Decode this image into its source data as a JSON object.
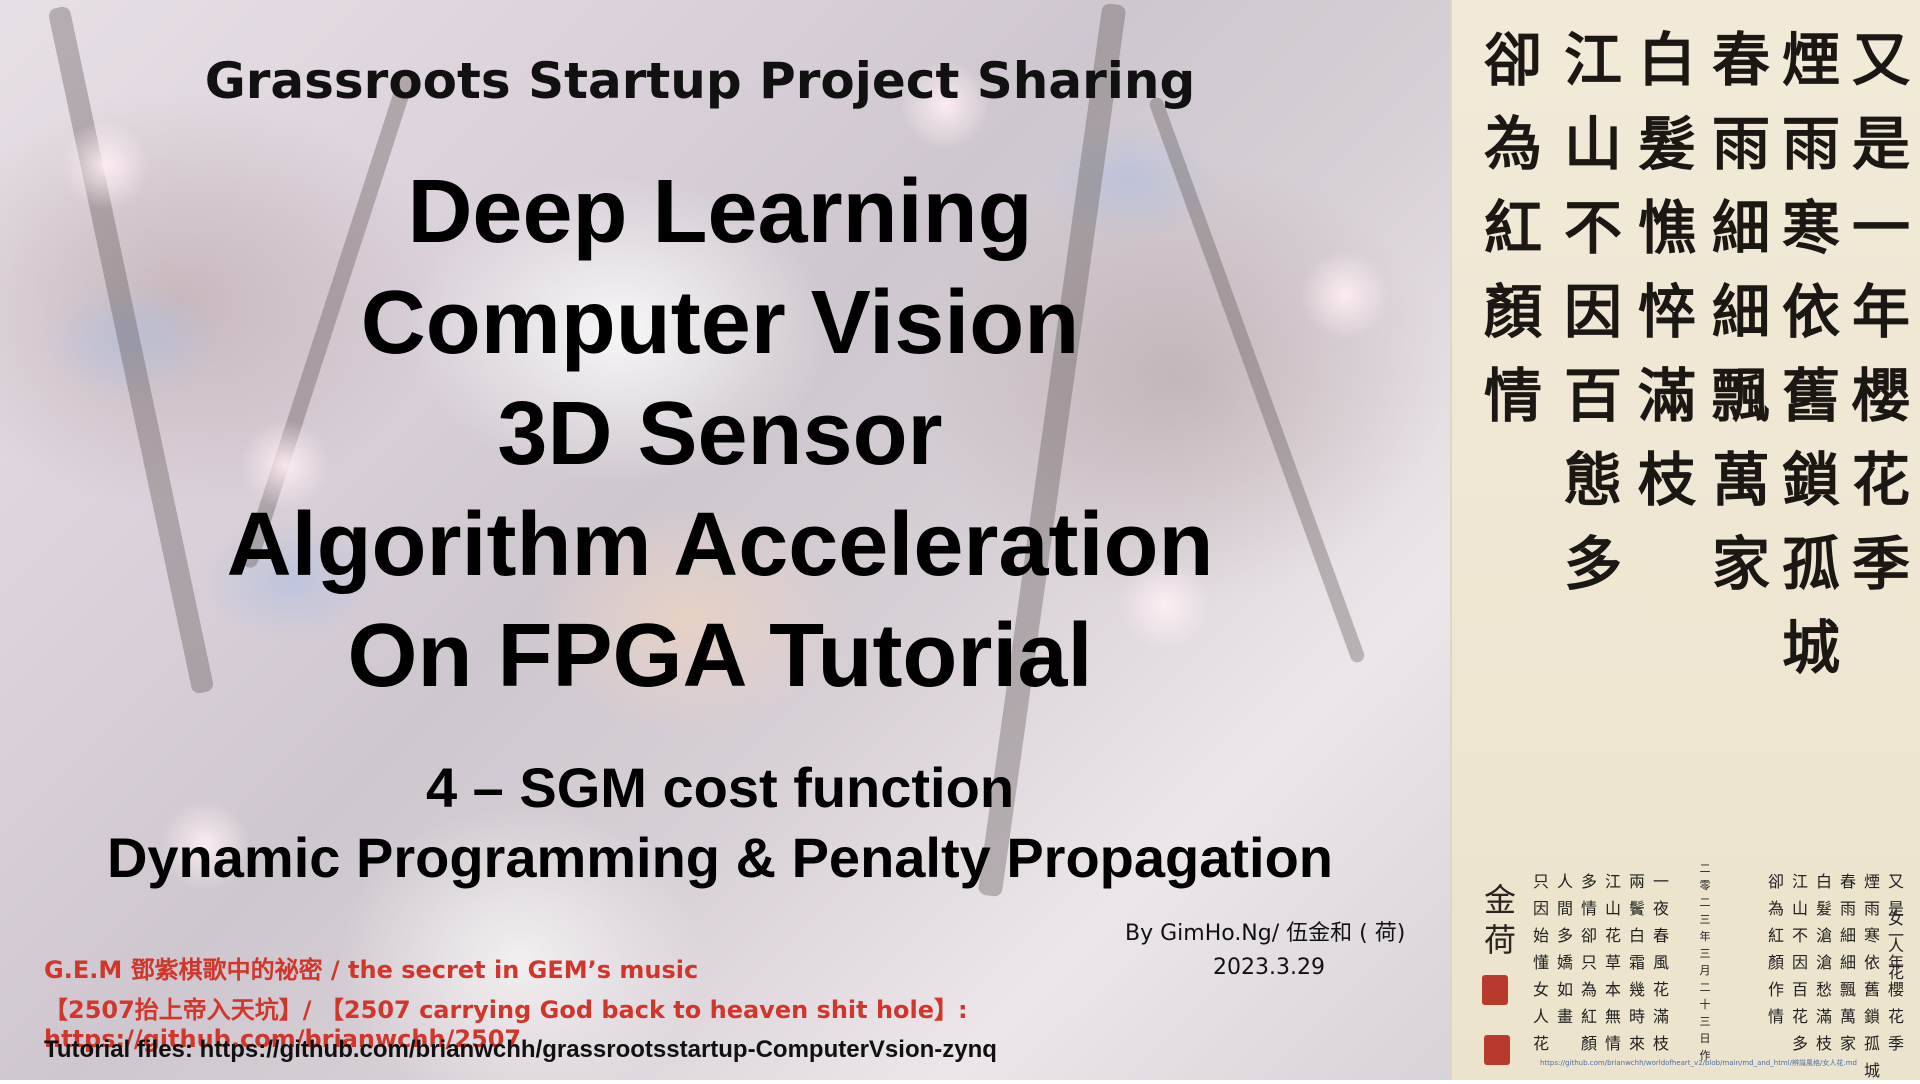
{
  "slide": {
    "header": "Grassroots Startup Project Sharing",
    "title_lines": [
      "Deep Learning",
      "Computer Vision",
      "3D Sensor",
      "Algorithm Acceleration",
      "On FPGA Tutorial"
    ],
    "part_lines": [
      "4 – SGM cost function",
      "Dynamic Programming  & Penalty Propagation"
    ],
    "author": "By GimHo.Ng/ 伍金和 ( 荷)",
    "date": "2023.3.29",
    "red_lines": [
      "G.E.M 鄧紫棋歌中的祕密 / the secret in GEM’s music",
      "【2507抬上帝入天坑】/ 【2507 carrying God back to heaven shit hole】:  https://github.com/brianwchh/2507"
    ],
    "tutorial_files": "Tutorial files: https://github.com/brianwchh/grassrootsstartup-ComputerVsion-zynq"
  },
  "calligraphy": {
    "columns": [
      "又是一年櫻花季",
      "煙雨寒依舊鎖孤城",
      "春雨細細飄萬家",
      "白髮憔悴滿枝",
      "江山不因百態多",
      "卻為紅顏情"
    ],
    "print_columns": [
      "又是一年櫻花季",
      "煙雨寒依舊鎖孤城",
      "春雨細細飄萬家",
      "白髮滄滄愁滿枝",
      "江山不因百花多",
      "卻為紅顏作情"
    ],
    "print_columns_2": [
      "一夜春風花滿枝",
      "兩鬢白霜幾時來",
      "江山花草本無情",
      "多情卻只為紅顏",
      "人間多嬌如畫",
      "只因始懂女人花"
    ],
    "date_col": "二零二三年三月二十三日　作",
    "title_col": "女人花",
    "signature": "金荷",
    "url": "https://github.com/brianwchh/worldofheart_v2/blob/main/md_and_html/辨識風格/女人花.md"
  }
}
